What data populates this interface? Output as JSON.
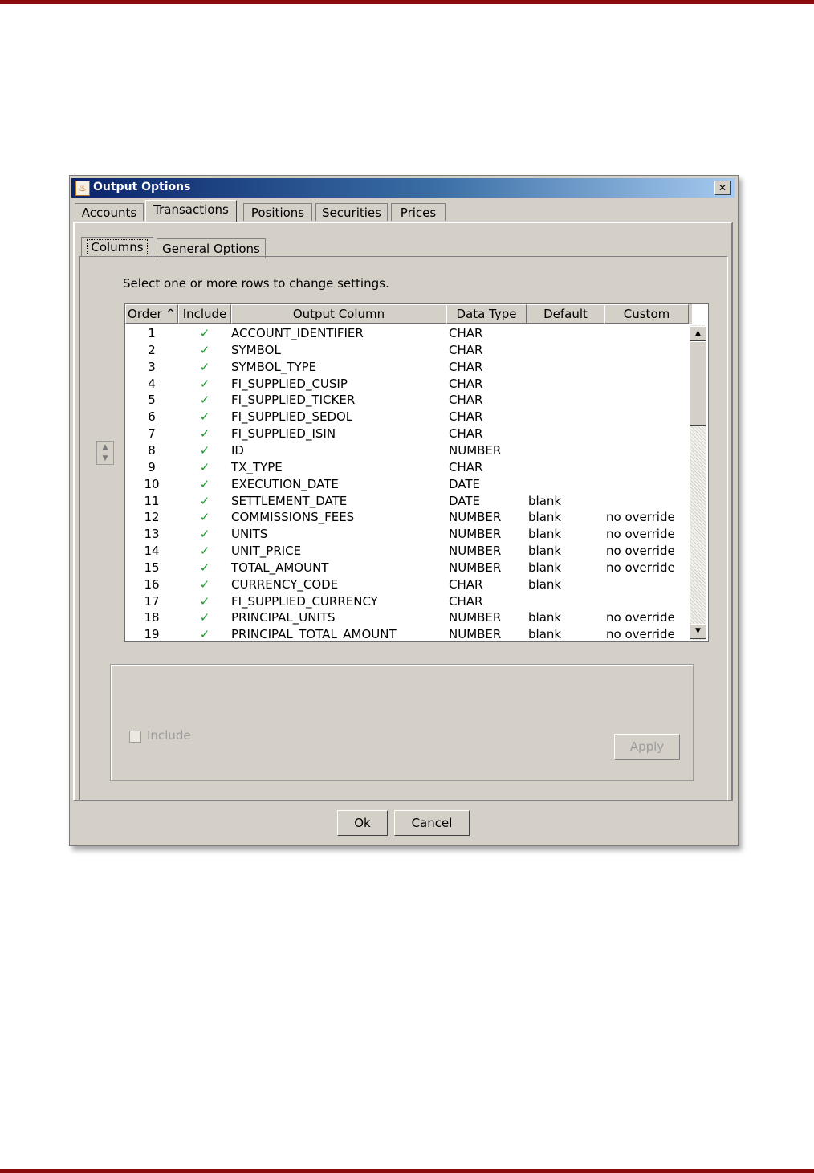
{
  "dialog": {
    "title": "Output Options",
    "close_glyph": "✕"
  },
  "tabs": [
    "Accounts",
    "Transactions",
    "Positions",
    "Securities",
    "Prices"
  ],
  "active_tab": "Transactions",
  "subtabs": [
    "Columns",
    "General Options"
  ],
  "active_subtab": "Columns",
  "hint": "Select one or more rows to change settings.",
  "table": {
    "headers": [
      "Order ^",
      "Include",
      "Output Column",
      "Data Type",
      "Default",
      "Custom"
    ],
    "rows": [
      {
        "order": "1",
        "include": "✓",
        "column": "ACCOUNT_IDENTIFIER",
        "type": "CHAR",
        "default": "",
        "custom": ""
      },
      {
        "order": "2",
        "include": "✓",
        "column": "SYMBOL",
        "type": "CHAR",
        "default": "",
        "custom": ""
      },
      {
        "order": "3",
        "include": "✓",
        "column": "SYMBOL_TYPE",
        "type": "CHAR",
        "default": "",
        "custom": ""
      },
      {
        "order": "4",
        "include": "✓",
        "column": "FI_SUPPLIED_CUSIP",
        "type": "CHAR",
        "default": "",
        "custom": ""
      },
      {
        "order": "5",
        "include": "✓",
        "column": "FI_SUPPLIED_TICKER",
        "type": "CHAR",
        "default": "",
        "custom": ""
      },
      {
        "order": "6",
        "include": "✓",
        "column": "FI_SUPPLIED_SEDOL",
        "type": "CHAR",
        "default": "",
        "custom": ""
      },
      {
        "order": "7",
        "include": "✓",
        "column": "FI_SUPPLIED_ISIN",
        "type": "CHAR",
        "default": "",
        "custom": ""
      },
      {
        "order": "8",
        "include": "✓",
        "column": "ID",
        "type": "NUMBER",
        "default": "",
        "custom": ""
      },
      {
        "order": "9",
        "include": "✓",
        "column": "TX_TYPE",
        "type": "CHAR",
        "default": "",
        "custom": ""
      },
      {
        "order": "10",
        "include": "✓",
        "column": "EXECUTION_DATE",
        "type": "DATE",
        "default": "",
        "custom": ""
      },
      {
        "order": "11",
        "include": "✓",
        "column": "SETTLEMENT_DATE",
        "type": "DATE",
        "default": "blank",
        "custom": ""
      },
      {
        "order": "12",
        "include": "✓",
        "column": "COMMISSIONS_FEES",
        "type": "NUMBER",
        "default": "blank",
        "custom": "no override"
      },
      {
        "order": "13",
        "include": "✓",
        "column": "UNITS",
        "type": "NUMBER",
        "default": "blank",
        "custom": "no override"
      },
      {
        "order": "14",
        "include": "✓",
        "column": "UNIT_PRICE",
        "type": "NUMBER",
        "default": "blank",
        "custom": "no override"
      },
      {
        "order": "15",
        "include": "✓",
        "column": "TOTAL_AMOUNT",
        "type": "NUMBER",
        "default": "blank",
        "custom": "no override"
      },
      {
        "order": "16",
        "include": "✓",
        "column": "CURRENCY_CODE",
        "type": "CHAR",
        "default": "blank",
        "custom": ""
      },
      {
        "order": "17",
        "include": "✓",
        "column": "FI_SUPPLIED_CURRENCY",
        "type": "CHAR",
        "default": "",
        "custom": ""
      },
      {
        "order": "18",
        "include": "✓",
        "column": "PRINCIPAL_UNITS",
        "type": "NUMBER",
        "default": "blank",
        "custom": "no override"
      },
      {
        "order": "19",
        "include": "✓",
        "column": "PRINCIPAL_TOTAL_AMOUNT",
        "type": "NUMBER",
        "default": "blank",
        "custom": "no override"
      }
    ]
  },
  "scroll": {
    "up_glyph": "▲",
    "down_glyph": "▼"
  },
  "reorder": {
    "up_glyph": "▲",
    "down_glyph": "▼"
  },
  "settings": {
    "include_label": "Include",
    "apply_label": "Apply"
  },
  "buttons": {
    "ok": "Ok",
    "cancel": "Cancel"
  },
  "colors": {
    "page_rule": "#8b0a0a",
    "dialog_bg": "#d4d0c8",
    "check": "#1a9a2a"
  },
  "icons": {
    "app": "java-cup-icon"
  }
}
